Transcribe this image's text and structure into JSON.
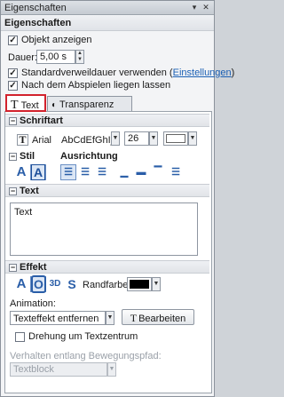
{
  "window": {
    "title": "Eigenschaften"
  },
  "section": {
    "title": "Eigenschaften"
  },
  "objekt_anzeigen": {
    "label": "Objekt anzeigen",
    "checked": true
  },
  "dauer": {
    "label": "Dauer:",
    "value": "5,00 s"
  },
  "standardverweildauer": {
    "label": "Standardverweildauer verwenden (",
    "link": "Einstellungen",
    "suffix": ")",
    "checked": true
  },
  "nach_abspielen": {
    "label": "Nach dem Abspielen liegen lassen",
    "checked": true
  },
  "tabs": [
    {
      "label": "Text",
      "icon": "text-T-icon",
      "active": true
    },
    {
      "label": "Transparenz",
      "icon": "transparency-icon",
      "active": false
    }
  ],
  "schriftart": {
    "title": "Schriftart",
    "font_name": "Arial",
    "preview": "AbCdEfGhIj",
    "size": "26",
    "color": "#ffffff"
  },
  "stil": {
    "title": "Stil",
    "ausrichtung_title": "Ausrichtung"
  },
  "text_group": {
    "title": "Text",
    "content": "Text"
  },
  "effekt": {
    "title": "Effekt",
    "randfarbe_label": "Randfarbe:",
    "randfarbe_color": "#000000",
    "animation_label": "Animation:",
    "animation_value": "Texteffekt entfernen",
    "bearbeiten_label": "Bearbeiten",
    "drehung_label": "Drehung um Textzentrum",
    "drehung_checked": false,
    "pfad_label": "Verhalten entlang Bewegungspfad:",
    "pfad_value": "Textblock"
  }
}
